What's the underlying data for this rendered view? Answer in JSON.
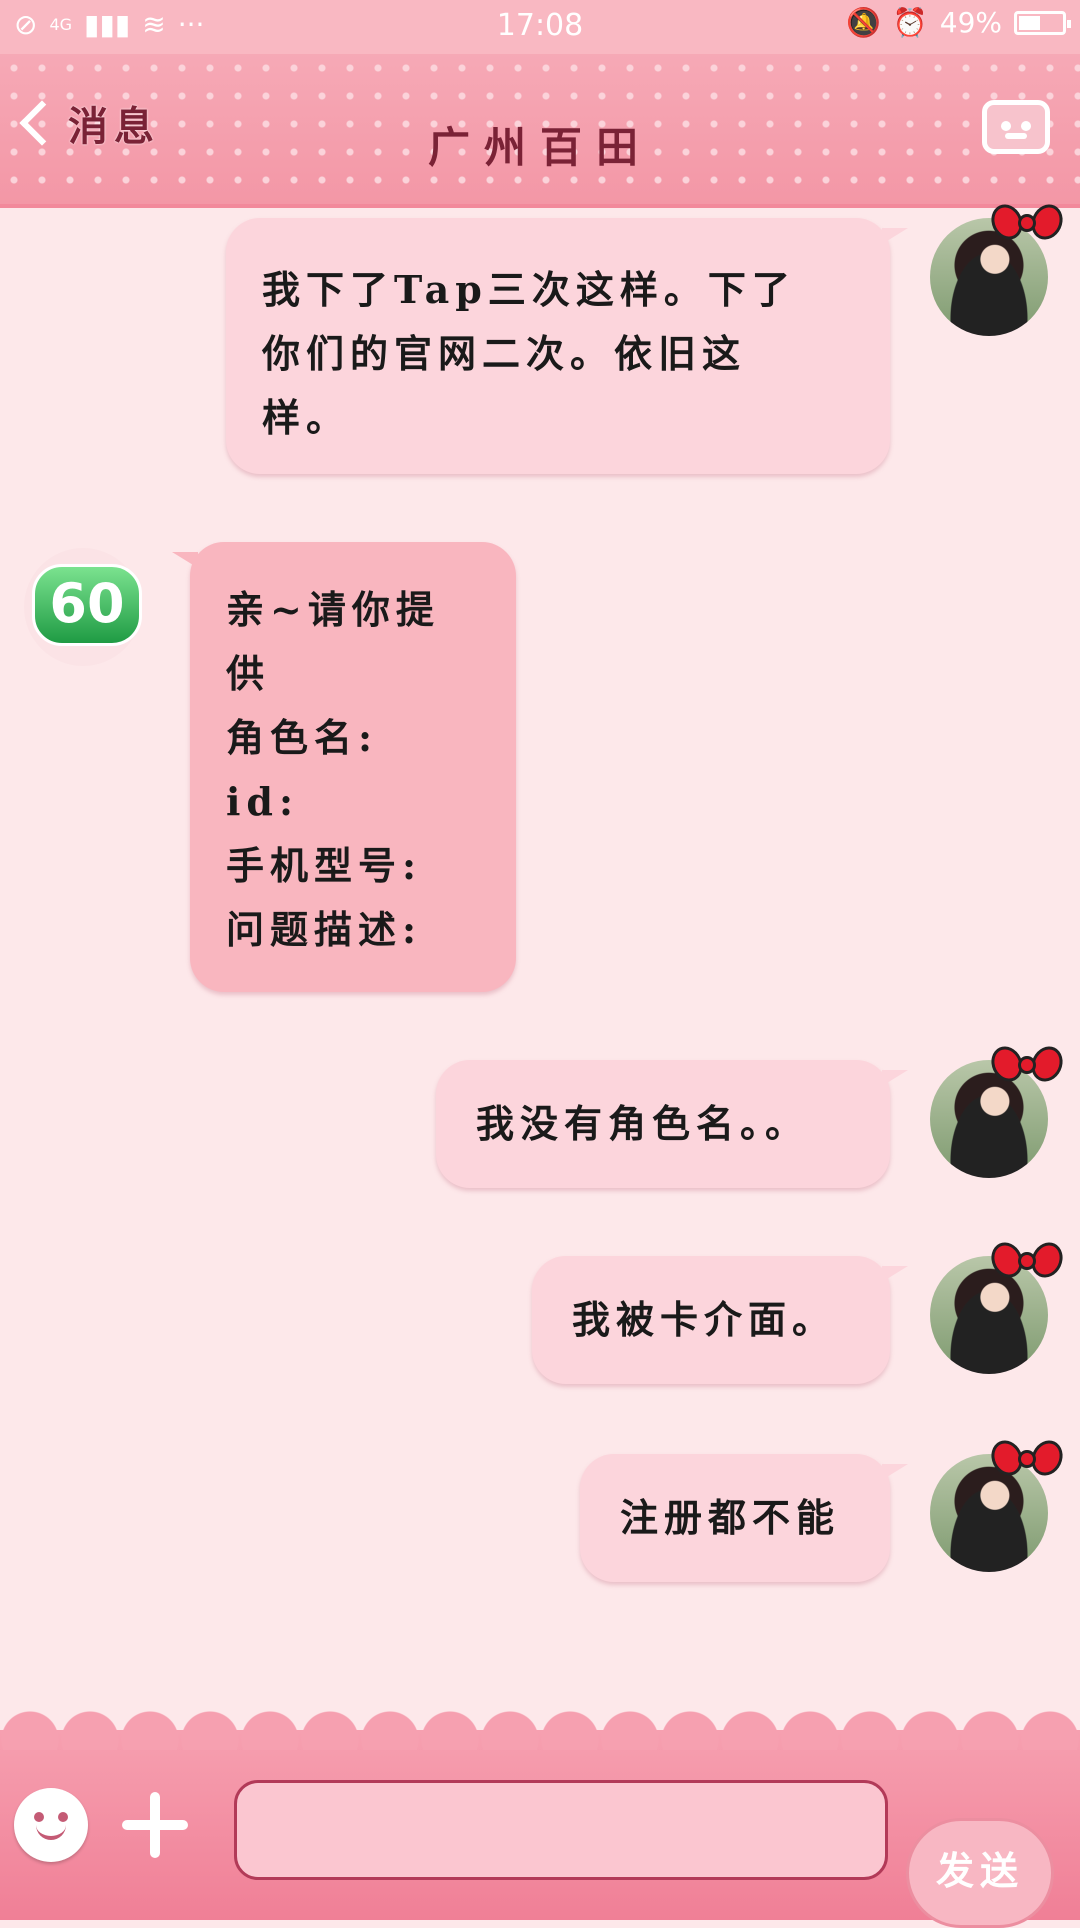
{
  "status_bar": {
    "time": "17:08",
    "network": "4G",
    "battery_percent": "49%",
    "battery_level": 0.49,
    "icons": [
      "no-sim-icon",
      "signal-icon",
      "wifi-icon",
      "more-dots-icon",
      "mute-bell-icon",
      "alarm-icon",
      "battery-icon"
    ]
  },
  "header": {
    "back_label": "消息",
    "title": "广州百田",
    "profile_icon": "profile-card-icon"
  },
  "messages": [
    {
      "sender": "me",
      "text": "我下了Tap三次这样。下了\n你们的官网二次。依旧这\n样。"
    },
    {
      "sender": "other",
      "text": "亲~请你提供\n角色名:\nid:\n手机型号:\n问题描述:\n"
    },
    {
      "sender": "me",
      "text": "我没有角色名。。"
    },
    {
      "sender": "me",
      "text": "我被卡介面。"
    },
    {
      "sender": "me",
      "text": "注册都不能"
    }
  ],
  "agent_avatar_text": "60",
  "composer": {
    "input_value": "",
    "send_label": "发送"
  },
  "colors": {
    "header_pink": "#f6a9b6",
    "bubble_me": "#fcd5dc",
    "bubble_other": "#f9b6bf",
    "background": "#fde8ea",
    "title_text": "#7a2236"
  }
}
